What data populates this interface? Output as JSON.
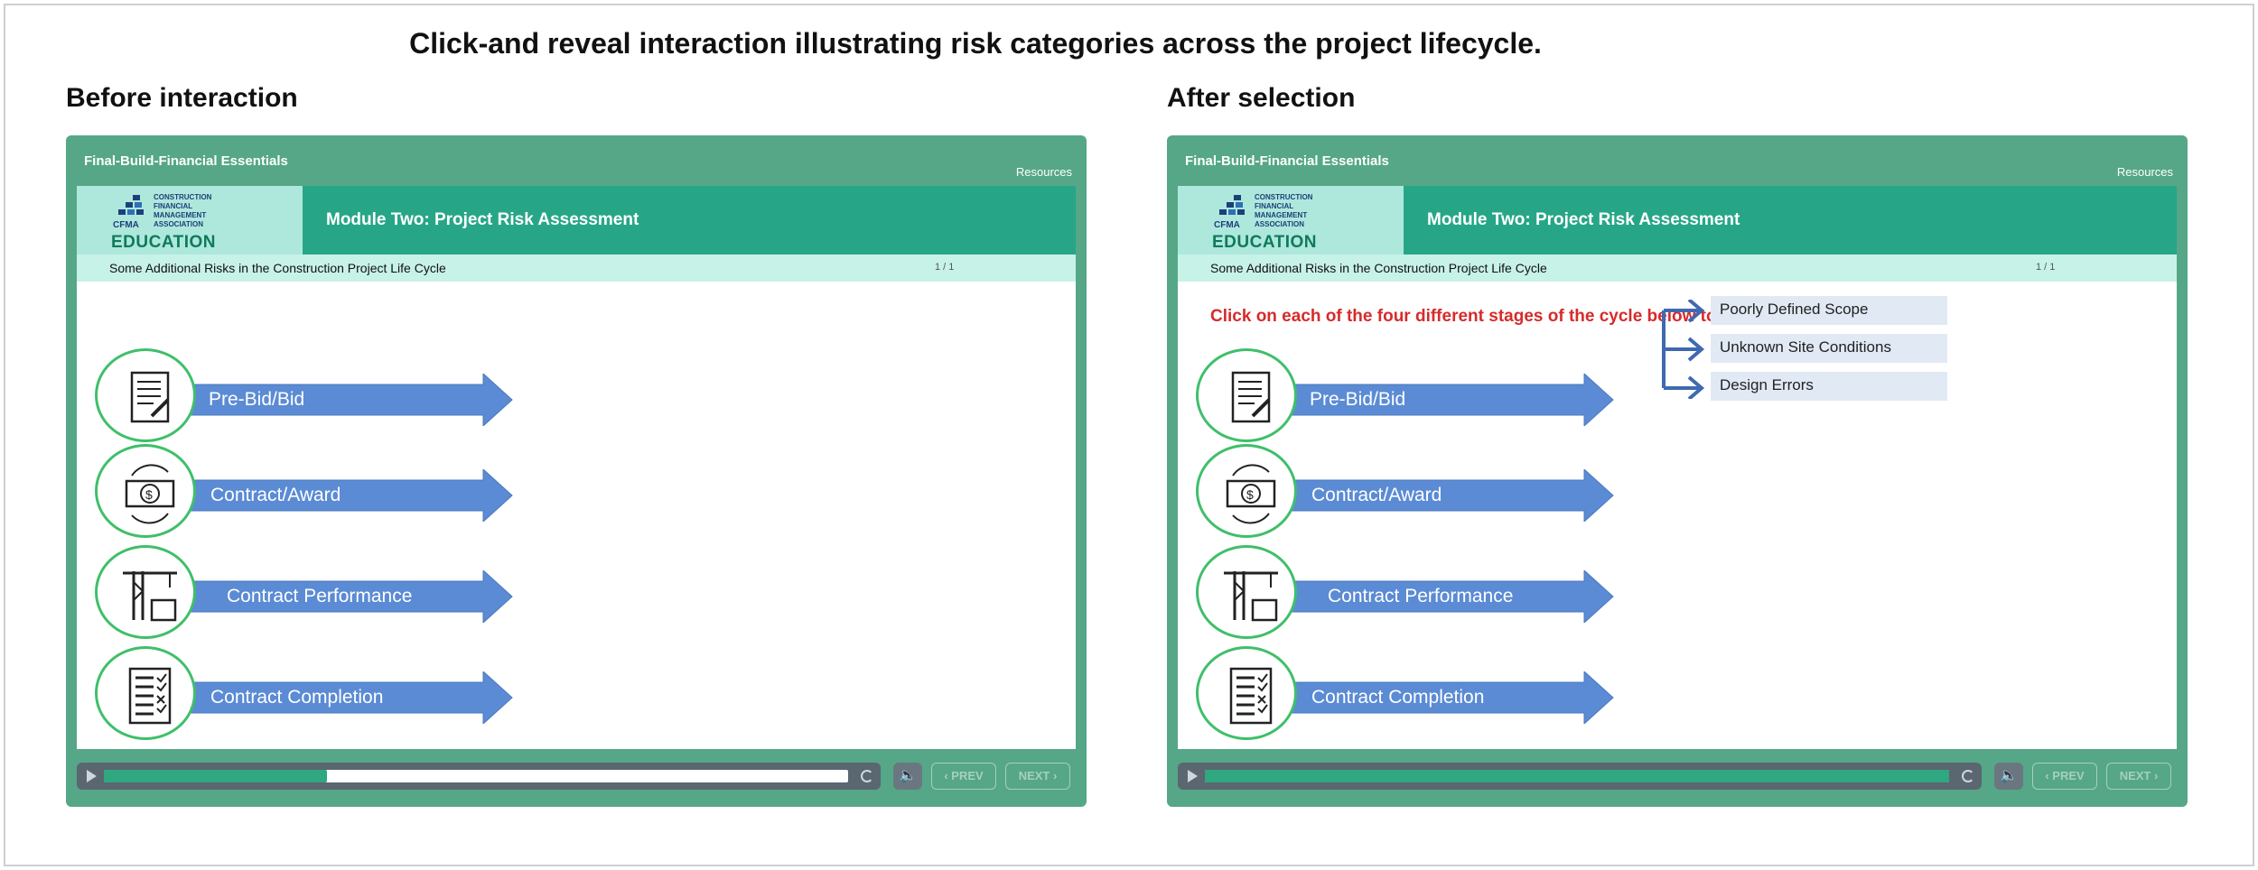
{
  "caption": "Click-and reveal interaction illustrating risk categories across the project lifecycle.",
  "panels": [
    {
      "label": "Before interaction",
      "course_title": "Final-Build-Financial Essentials",
      "resources": "Resources",
      "logo_lines": [
        "CONSTRUCTION",
        "FINANCIAL",
        "MANAGEMENT",
        "ASSOCIATION"
      ],
      "logo_mark": "CFMA",
      "logo_education": "EDUCATION",
      "module_title": "Module Two: Project Risk Assessment",
      "slide_title": "Some Additional Risks in the Construction Project Life Cycle",
      "page_indicator": "1 / 1",
      "instruction": "",
      "stages": [
        {
          "label": "Pre-Bid/Bid",
          "icon": "document-pencil-icon"
        },
        {
          "label": "Contract/Award",
          "icon": "money-cycle-icon"
        },
        {
          "label": "Contract Performance",
          "icon": "crane-icon"
        },
        {
          "label": "Contract Completion",
          "icon": "checklist-icon"
        }
      ],
      "risks": [],
      "progress": 0.3,
      "prev_label": "‹ PREV",
      "next_label": "NEXT ›"
    },
    {
      "label": "After selection",
      "course_title": "Final-Build-Financial Essentials",
      "resources": "Resources",
      "logo_lines": [
        "CONSTRUCTION",
        "FINANCIAL",
        "MANAGEMENT",
        "ASSOCIATION"
      ],
      "logo_mark": "CFMA",
      "logo_education": "EDUCATION",
      "module_title": "Module Two: Project Risk Assessment",
      "slide_title": "Some Additional Risks in the Construction Project Life Cycle",
      "page_indicator": "1 / 1",
      "instruction": "Click on each of the four different stages of the cycle below to learn more.",
      "stages": [
        {
          "label": "Pre-Bid/Bid",
          "icon": "document-pencil-icon"
        },
        {
          "label": "Contract/Award",
          "icon": "money-cycle-icon"
        },
        {
          "label": "Contract Performance",
          "icon": "crane-icon"
        },
        {
          "label": "Contract Completion",
          "icon": "checklist-icon"
        }
      ],
      "risks": [
        "Poorly Defined Scope",
        "Unknown Site Conditions",
        "Design Errors"
      ],
      "progress": 1.0,
      "prev_label": "‹ PREV",
      "next_label": "NEXT ›"
    }
  ],
  "colors": {
    "player": "#55a787",
    "module_bar": "#27a687",
    "arrow": "#5b8bd4",
    "instruction": "#d62b2b",
    "icon_ring": "#3fbf6a"
  }
}
